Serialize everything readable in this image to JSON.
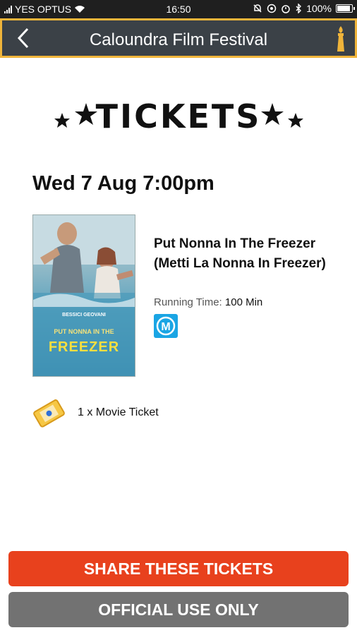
{
  "status_bar": {
    "carrier": "YES OPTUS",
    "time": "16:50",
    "battery": "100%",
    "battery_level": 1.0
  },
  "app_bar": {
    "title": "Caloundra Film Festival",
    "back_icon": "chevron-left-icon",
    "logo_icon": "torch-icon",
    "accent_color": "#f0b43a",
    "background_color": "#3b4147"
  },
  "heading": {
    "text": "TICKETS"
  },
  "session": {
    "date_time": "Wed 7 Aug 7:00pm"
  },
  "film": {
    "title": "Put Nonna In The Freezer (Metti La Nonna In Freezer)",
    "running_time_label": "Running Time:",
    "running_time_value": "100 Min",
    "rating": "M",
    "rating_color": "#1aa5e4",
    "poster": {
      "names": "BESSICI   GEOVANI",
      "line1": "PUT NONNA IN THE",
      "line2": "FREEZER"
    }
  },
  "tickets": {
    "summary": "1 x Movie Ticket",
    "icon": "ticket-icon"
  },
  "actions": {
    "share_label": "SHARE THESE TICKETS",
    "share_color": "#e8411d",
    "official_label": "OFFICIAL USE ONLY",
    "official_color": "#727272"
  }
}
